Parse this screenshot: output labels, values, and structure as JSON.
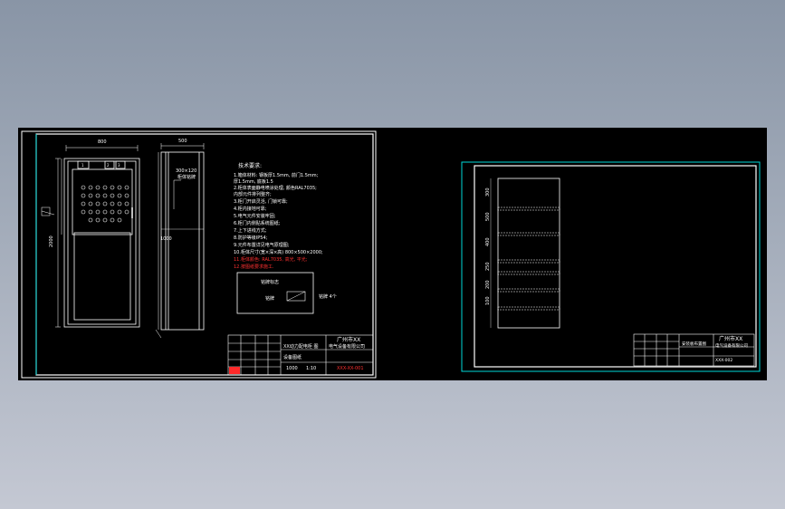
{
  "sheet1": {
    "dims": {
      "width_top": "800",
      "depth_top": "500",
      "height_side": "2000",
      "height_mid": "1000"
    },
    "callout": "300×120",
    "callout2": "柜体铭牌",
    "notes": {
      "title": "技术要求:",
      "lines": [
        "1.箱体材料: 钢板厚1.5mm, 前门1.5mm;",
        "  厚1.5mm, 底板1.5",
        "2.柜体表面静电喷涂处理, 颜色RAL7035;",
        "  内部元件排列整齐;",
        "3.柜门开启灵活, 门锁可靠;",
        "4.柜内接地可靠;",
        "5.电气元件安装牢固;",
        "6.柜门内侧贴系统图纸;",
        "7.上下进线方式;",
        "8.防护等级IP54;",
        "9.元件布置详见电气原理图;",
        "10.柜体尺寸(宽×深×高) 800×500×2000;"
      ],
      "red_lines": [
        "11.柜体颜色: RAL7035, 高光, 平光;",
        "12.按图纸要求施工."
      ]
    },
    "label_box": {
      "title": "铭牌标志",
      "item": "铭牌",
      "right": "铭牌 4个"
    },
    "title_block": {
      "company": "广州市XX",
      "company2": "电气设备有限公司",
      "drawing": "XX动力配电柜 图",
      "sub": "设备图纸",
      "code": "1000",
      "scale": "1:10",
      "number": "XXX-XX-001"
    }
  },
  "sheet2": {
    "dims": [
      "300",
      "500",
      "400",
      "250",
      "200",
      "100"
    ],
    "title_block": {
      "company": "广州市XX",
      "company2": "电气设备有限公司",
      "drawing": "安装板布置图",
      "number": "XXX-002"
    }
  }
}
